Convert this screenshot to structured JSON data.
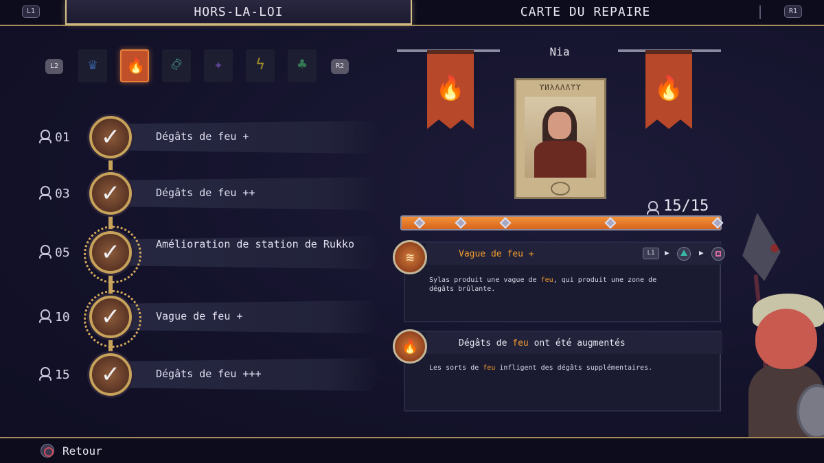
{
  "top_tabs": {
    "left_shoulder": "L1",
    "right_shoulder": "R1",
    "active_tab": "HORS-LA-LOI",
    "inactive_tab": "CARTE DU REPAIRE"
  },
  "categories": {
    "left_shoulder": "L2",
    "right_shoulder": "R2",
    "items": [
      {
        "icon": "crown-icon",
        "glyph": "♛",
        "color": "#3a6aa8",
        "active": false
      },
      {
        "icon": "fire-icon",
        "glyph": "🔥",
        "color": "#e8823c",
        "active": true
      },
      {
        "icon": "wind-icon",
        "glyph": "࿂",
        "color": "#4a9a8a",
        "active": false
      },
      {
        "icon": "butterfly-icon",
        "glyph": "✦",
        "color": "#6a4aa8",
        "active": false
      },
      {
        "icon": "lightning-icon",
        "glyph": "ϟ",
        "color": "#b8a030",
        "active": false
      },
      {
        "icon": "leaf-icon",
        "glyph": "♣",
        "color": "#3a8a5a",
        "active": false
      }
    ]
  },
  "skills": [
    {
      "level": "01",
      "text": "Dégâts de feu +"
    },
    {
      "level": "03",
      "text": "Dégâts de feu ++"
    },
    {
      "level": "05",
      "text": "Amélioration de station de Rukko"
    },
    {
      "level": "10",
      "text": "Vague de feu +"
    },
    {
      "level": "15",
      "text": "Dégâts de feu +++"
    }
  ],
  "character": {
    "name": "Nia",
    "poster_title": "ϒͶλΛΛΛϒϒ",
    "progress_text": "15/15",
    "progress_value": 1.0,
    "milestones": [
      1,
      3,
      5,
      10,
      15
    ]
  },
  "cards": [
    {
      "title": "Vague de feu +",
      "title_color": "#f29a2e",
      "button_l1": "L1",
      "desc_before": "Sylas produit une vague de ",
      "desc_highlight": "feu",
      "desc_after": ", qui produit une zone de dégâts brûlante.",
      "badge_icon": "fire-wave-icon"
    },
    {
      "title_before": "Dégâts de ",
      "title_highlight": "feu",
      "title_after": " ont été augmentés",
      "desc_before": "Les sorts de ",
      "desc_highlight": "feu",
      "desc_after": " infligent des dégâts supplémentaires.",
      "badge_icon": "flame-icon"
    }
  ],
  "footer": {
    "back_label": "Retour"
  },
  "colors": {
    "accent_orange": "#f29a2e",
    "gold_border": "#c6a25a",
    "background": "#14132a"
  }
}
